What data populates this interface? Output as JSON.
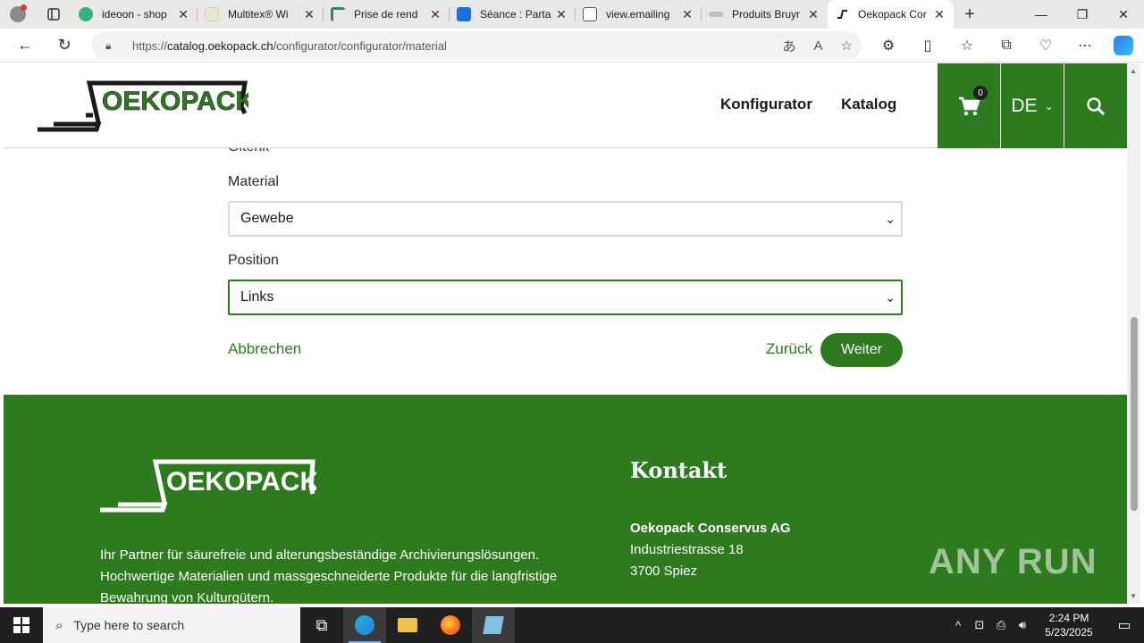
{
  "browser": {
    "tabs": [
      {
        "title": "ideoon - shop",
        "favicon_color": "#3ab07a"
      },
      {
        "title": "Multitex® Wi",
        "favicon_color": "#d9c7a0"
      },
      {
        "title": "Prise de rend",
        "favicon_color": "#2e8b57"
      },
      {
        "title": "Séance : Parta",
        "favicon_color": "#1e6fd9"
      },
      {
        "title": "view.emailing",
        "favicon_color": "#777777"
      },
      {
        "title": "Produits Bruyr",
        "favicon_color": "#a0a0a0"
      },
      {
        "title": "Oekopack Cor",
        "favicon_color": "#222222"
      }
    ],
    "url_prefix": "https://",
    "url_host": "catalog.oekopack.ch",
    "url_path": "/configurator/configurator/material"
  },
  "site": {
    "nav": {
      "konfigurator": "Konfigurator",
      "katalog": "Katalog"
    },
    "cart_count": "0",
    "language": "DE",
    "brand_color": "#2d7a1f"
  },
  "form": {
    "cut_heading": "Gitenk",
    "material_label": "Material",
    "material_value": "Gewebe",
    "position_label": "Position",
    "position_value": "Links",
    "cancel": "Abbrechen",
    "back": "Zurück",
    "next": "Weiter"
  },
  "footer": {
    "description": "Ihr Partner für säurefreie und alterungsbeständige Archivierungslösungen. Hochwertige Materialien und massgeschneiderte Produkte für die langfristige Bewahrung von Kulturgütern.",
    "contact_heading": "Kontakt",
    "company": "Oekopack Conservus AG",
    "street": "Industriestrasse 18",
    "city": "3700 Spiez"
  },
  "watermark": "ANY RUN",
  "taskbar": {
    "search_placeholder": "Type here to search",
    "time": "2:24 PM",
    "date": "5/23/2025"
  }
}
